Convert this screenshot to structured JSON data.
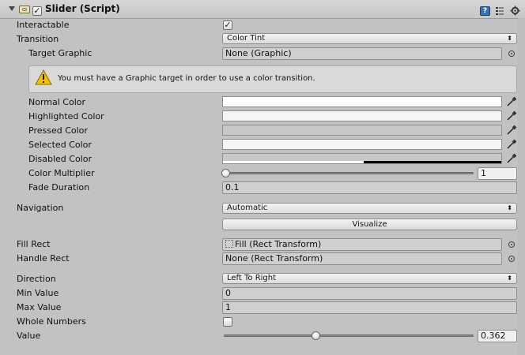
{
  "component": {
    "title": "Slider (Script)",
    "enabled": true
  },
  "props": {
    "interactable_label": "Interactable",
    "interactable": true,
    "transition_label": "Transition",
    "transition_value": "Color Tint",
    "target_graphic_label": "Target Graphic",
    "target_graphic_value": "None (Graphic)",
    "warning_text": "You must have a Graphic target in order to use a color transition.",
    "normal_color_label": "Normal Color",
    "highlighted_color_label": "Highlighted Color",
    "pressed_color_label": "Pressed Color",
    "selected_color_label": "Selected Color",
    "disabled_color_label": "Disabled Color",
    "color_multiplier_label": "Color Multiplier",
    "color_multiplier_value": "1",
    "color_multiplier_fraction": 0.0,
    "fade_duration_label": "Fade Duration",
    "fade_duration_value": "0.1",
    "navigation_label": "Navigation",
    "navigation_value": "Automatic",
    "visualize_label": "Visualize",
    "fill_rect_label": "Fill Rect",
    "fill_rect_value": "Fill (Rect Transform)",
    "handle_rect_label": "Handle Rect",
    "handle_rect_value": "None (Rect Transform)",
    "direction_label": "Direction",
    "direction_value": "Left To Right",
    "min_value_label": "Min Value",
    "min_value": "0",
    "max_value_label": "Max Value",
    "max_value": "1",
    "whole_numbers_label": "Whole Numbers",
    "whole_numbers": false,
    "value_label": "Value",
    "value": "0.362",
    "value_fraction": 0.362
  },
  "colors": {
    "normal": "#ffffff",
    "highlighted": "#f5f5f5",
    "pressed": "#c8c8c8",
    "selected": "#f5f5f5",
    "disabled": "#c8c8c8"
  },
  "icons": {
    "foldout": "triangle-down-icon",
    "script": "script-icon",
    "help": "help-icon",
    "preset": "preset-icon",
    "settings": "gear-icon",
    "warning": "warning-icon",
    "eyedropper": "eyedropper-icon",
    "object_picker": "object-picker-icon"
  }
}
